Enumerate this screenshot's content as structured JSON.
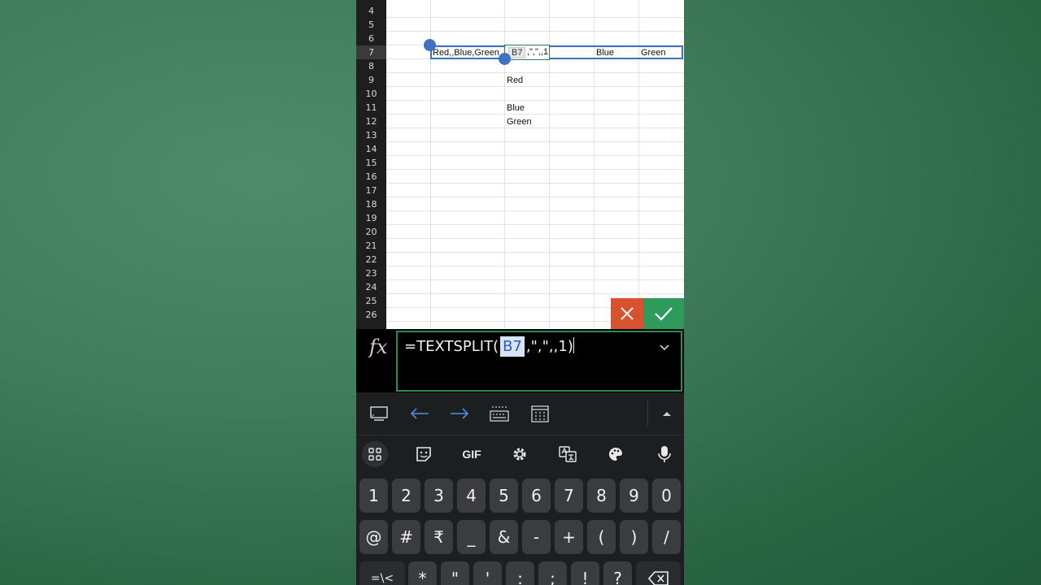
{
  "sheet": {
    "row_numbers": [
      "4",
      "5",
      "6",
      "7",
      "8",
      "9",
      "10",
      "11",
      "12",
      "13",
      "14",
      "15",
      "16",
      "17",
      "18",
      "19",
      "20",
      "21",
      "22",
      "23",
      "24",
      "25",
      "26"
    ],
    "selected_row": "7",
    "cells": {
      "b7": "Red,,Blue,Green",
      "c9": "Red",
      "c11": "Blue",
      "c12": "Green",
      "e7": "Blue",
      "f7": "Green"
    },
    "edit_cell": {
      "ref": "B7",
      "rest": ",\",\",,1"
    },
    "selection_color": "#3f72c2",
    "cancel_color": "#d9522f",
    "confirm_color": "#2e9a5b"
  },
  "formula_bar": {
    "fx_label": "fx",
    "prefix": "=TEXTSPLIT(",
    "ref": "B7",
    "suffix": ",\",\",,1",
    "close_paren": ")"
  },
  "keyboard": {
    "toolbar1_icons": [
      "screen-icon",
      "arrow-left-icon",
      "arrow-right-icon",
      "numeric-keyboard-icon",
      "calculator-grid-icon",
      "collapse-up-icon"
    ],
    "toolbar2": {
      "gif_label": "GIF"
    },
    "row1": [
      "1",
      "2",
      "3",
      "4",
      "5",
      "6",
      "7",
      "8",
      "9",
      "0"
    ],
    "row2": [
      "@",
      "#",
      "₹",
      "_",
      "&",
      "-",
      "+",
      "(",
      ")",
      "/"
    ],
    "row3": [
      "=\\<",
      "*",
      "\"",
      "'",
      ":",
      ";",
      "!",
      "?"
    ]
  }
}
